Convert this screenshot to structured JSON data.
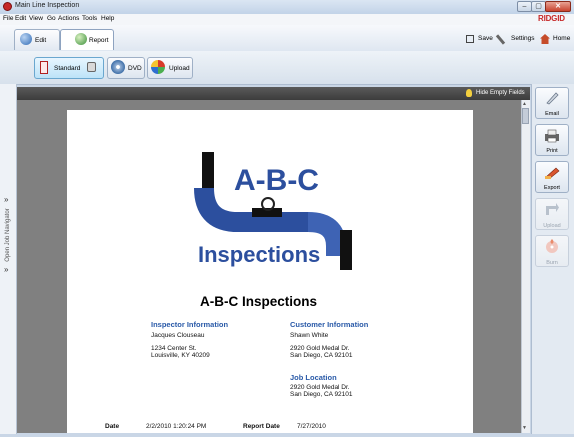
{
  "window": {
    "title": "Main Line Inspection",
    "min": "–",
    "max": "▢",
    "close": "✕"
  },
  "menu": [
    "File",
    "Edit",
    "View",
    "Go",
    "Actions",
    "Tools",
    "Help"
  ],
  "brand": "RIDGID",
  "tabs": {
    "edit": "Edit",
    "report": "Report"
  },
  "top_actions": {
    "save": "Save",
    "settings": "Settings",
    "home": "Home"
  },
  "subtoolbar": {
    "standard": "Standard",
    "dvd": "DVD",
    "upload": "Upload"
  },
  "navigator": {
    "label": "Open Job Navigator",
    "arrow": "»"
  },
  "viewer": {
    "hide_empty": "Hide Empty Fields",
    "scroll_up": "▲",
    "scroll_down": "▼"
  },
  "right_panel": {
    "email": "Email",
    "print": "Print",
    "export": "Export",
    "upload": "Upload",
    "burn": "Burn"
  },
  "report": {
    "logo_line1": "A-B-C",
    "logo_line2": "Inspections",
    "title": "A-B-C Inspections",
    "inspector_heading": "Inspector Information",
    "inspector_name": "Jacques Clouseau",
    "inspector_addr1": "1234 Center St.",
    "inspector_addr2": "Louisville, KY 40209",
    "customer_heading": "Customer Information",
    "customer_name": "Shawn White",
    "customer_addr1": "2920 Gold Medal Dr.",
    "customer_addr2": "San Diego, CA 92101",
    "job_heading": "Job Location",
    "job_addr1": "2920 Gold Medal Dr.",
    "job_addr2": "San Diego, CA 92101",
    "date_label": "Date",
    "date_value": "2/2/2010 1:20:24 PM",
    "report_date_label": "Report Date",
    "report_date_value": "7/27/2010"
  }
}
